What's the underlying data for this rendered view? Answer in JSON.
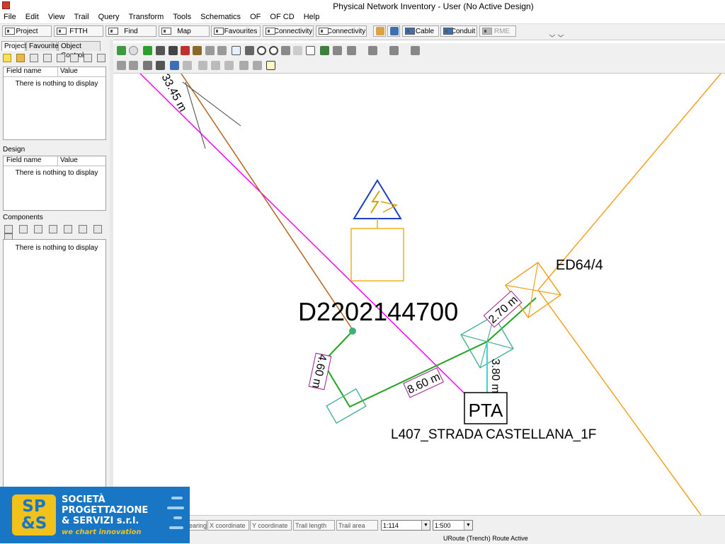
{
  "window": {
    "title": "Physical Network Inventory - User (No Active Design)"
  },
  "menu": [
    "File",
    "Edit",
    "View",
    "Trail",
    "Query",
    "Transform",
    "Tools",
    "Schematics",
    "OF",
    "OF CD",
    "Help"
  ],
  "toolbar": {
    "project": "Project",
    "ftth": "FTTH",
    "find": "Find",
    "map": "Map",
    "favourites": "Favourites",
    "connectivity1": "Connectivity",
    "connectivity2": "Connectivity",
    "cable": "Cable",
    "conduit": "Conduit",
    "rme": "RME"
  },
  "left_panel": {
    "tabs": [
      "Project",
      "Favourites",
      "Object Control"
    ],
    "field_name": "Field name",
    "value": "Value",
    "empty": "There is nothing to display",
    "design_label": "Design",
    "components_label": "Components"
  },
  "map": {
    "label_d": "D2202144700",
    "label_ed": "ED64/4",
    "label_pta": "PTA",
    "label_street": "L407_STRADA CASTELLANA_1F",
    "dist_top": "33.45 m",
    "dist_460": "4.60 m",
    "dist_860": "8.60 m",
    "dist_270": "2.70 m",
    "dist_380": "3.80 m"
  },
  "status": {
    "bearing": "Bearing",
    "x": "X coordinate",
    "y": "Y coordinate",
    "trail_length": "Trail length",
    "trail_area": "Trail area",
    "scale1": "1:114",
    "scale2": "1:500",
    "message": "URoute (Trench) Route Active"
  },
  "logo": {
    "mark_top": "SP",
    "mark_bottom": "&S",
    "line1": "SOCIETÀ",
    "line2": "PROGETTAZIONE",
    "line3": "& SERVIZI s.r.l.",
    "tagline": "we chart innovation"
  },
  "colors": {
    "magenta_line": "#ff00ff",
    "brown_line": "#b5651d",
    "orange_line": "#f5a020",
    "green_route": "#22a322",
    "teal_box": "#4fb39a",
    "cyan_line": "#34d7d7",
    "dim_label": "#9b1b8e",
    "logo_blue": "#1976c4",
    "logo_yellow": "#f2c21c"
  }
}
